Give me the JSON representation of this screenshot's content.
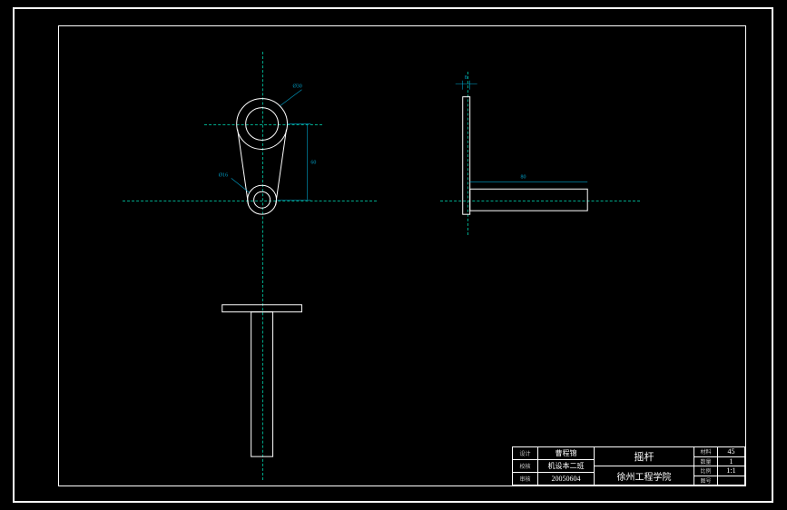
{
  "title_block": {
    "row1": {
      "label1": "设计",
      "value1": "曹程锦",
      "label2": "材料",
      "value2": "45"
    },
    "row2": {
      "label1": "校核",
      "value1": "机设本二班",
      "label2": "数量",
      "value2": "1"
    },
    "row3": {
      "label1": "审核",
      "value1": "20050604",
      "label2": "比例",
      "value2": "1:1"
    },
    "part_name": "摇杆",
    "institution": "徐州工程学院",
    "sheet_label": "图号",
    "sheet_value": ""
  },
  "dimensions": {
    "front_top_dia": "Ø30",
    "front_bot_dia": "Ø16",
    "front_height": "60",
    "side_thickness": "8",
    "side_length": "80"
  },
  "chart_data": {
    "type": "engineering_drawing",
    "views": [
      {
        "name": "front",
        "features": [
          "large_bore_top",
          "small_bore_bottom",
          "tapered_link"
        ]
      },
      {
        "name": "side",
        "features": [
          "thin_plate",
          "cylindrical_shaft"
        ]
      },
      {
        "name": "bottom",
        "features": [
          "thin_plate_top",
          "vertical_shaft"
        ]
      }
    ],
    "part": "rocker_arm"
  }
}
